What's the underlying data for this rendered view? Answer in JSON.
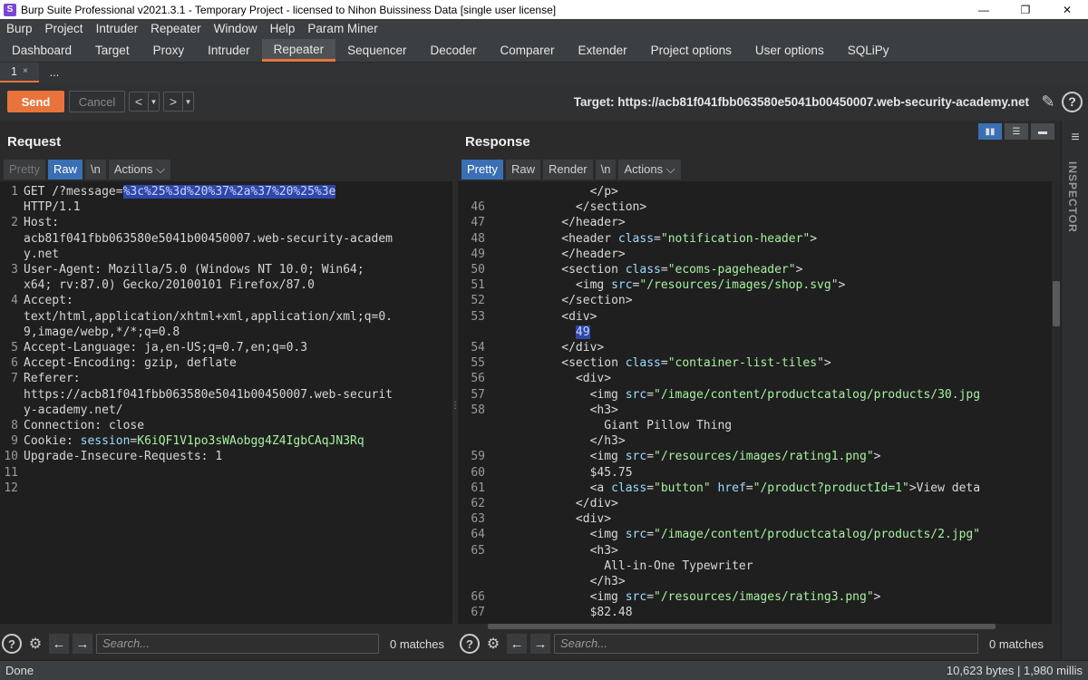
{
  "window": {
    "title": "Burp Suite Professional v2021.3.1 - Temporary Project - licensed to Nihon Buissiness Data [single user license]",
    "app_icon": "S",
    "minimize": "—",
    "restore": "❐",
    "close": "✕"
  },
  "menu": [
    "Burp",
    "Project",
    "Intruder",
    "Repeater",
    "Window",
    "Help",
    "Param Miner"
  ],
  "tabs": [
    "Dashboard",
    "Target",
    "Proxy",
    "Intruder",
    "Repeater",
    "Sequencer",
    "Decoder",
    "Comparer",
    "Extender",
    "Project options",
    "User options",
    "SQLiPy"
  ],
  "active_tab": "Repeater",
  "subtabs": [
    {
      "label": "1",
      "close": "×"
    },
    {
      "label": "...",
      "close": ""
    }
  ],
  "toolbar": {
    "send": "Send",
    "cancel": "Cancel",
    "back": "<",
    "forward": ">",
    "dropdown": "▼",
    "target": "Target: https://acb81f041fbb063580e5041b00450007.web-security-academy.net",
    "help": "?",
    "edit_icon": "pencil-icon"
  },
  "request": {
    "title": "Request",
    "buttons": [
      "Pretty",
      "Raw",
      "\\n",
      "Actions ⌵"
    ],
    "active": "Raw"
  },
  "response": {
    "title": "Response",
    "buttons": [
      "Pretty",
      "Raw",
      "Render",
      "\\n",
      "Actions ⌵"
    ],
    "active": "Pretty"
  },
  "request_lines": [
    {
      "ln": "1",
      "segs": [
        [
          "c-key",
          "GET /?message="
        ],
        [
          "c-hl",
          "%3c%25%3d%20%37%2a%37%20%25%3e"
        ]
      ]
    },
    {
      "ln": "",
      "segs": [
        [
          "c-key",
          "HTTP/1.1"
        ]
      ]
    },
    {
      "ln": "2",
      "segs": [
        [
          "c-key",
          "Host:"
        ]
      ]
    },
    {
      "ln": "",
      "segs": [
        [
          "c-text",
          "acb81f041fbb063580e5041b00450007.web-security-academ"
        ]
      ]
    },
    {
      "ln": "",
      "segs": [
        [
          "c-text",
          "y.net"
        ]
      ]
    },
    {
      "ln": "3",
      "segs": [
        [
          "c-key",
          "User-Agent: "
        ],
        [
          "c-text",
          "Mozilla/5.0 (Windows NT 10.0; Win64;"
        ]
      ]
    },
    {
      "ln": "",
      "segs": [
        [
          "c-text",
          "x64; rv:87.0) Gecko/20100101 Firefox/87.0"
        ]
      ]
    },
    {
      "ln": "4",
      "segs": [
        [
          "c-key",
          "Accept:"
        ]
      ]
    },
    {
      "ln": "",
      "segs": [
        [
          "c-text",
          "text/html,application/xhtml+xml,application/xml;q=0."
        ]
      ]
    },
    {
      "ln": "",
      "segs": [
        [
          "c-text",
          "9,image/webp,*/*;q=0.8"
        ]
      ]
    },
    {
      "ln": "5",
      "segs": [
        [
          "c-key",
          "Accept-Language: "
        ],
        [
          "c-text",
          "ja,en-US;q=0.7,en;q=0.3"
        ]
      ]
    },
    {
      "ln": "6",
      "segs": [
        [
          "c-key",
          "Accept-Encoding: "
        ],
        [
          "c-text",
          "gzip, deflate"
        ]
      ]
    },
    {
      "ln": "7",
      "segs": [
        [
          "c-key",
          "Referer:"
        ]
      ]
    },
    {
      "ln": "",
      "segs": [
        [
          "c-text",
          "https://acb81f041fbb063580e5041b00450007.web-securit"
        ]
      ]
    },
    {
      "ln": "",
      "segs": [
        [
          "c-text",
          "y-academy.net/"
        ]
      ]
    },
    {
      "ln": "8",
      "segs": [
        [
          "c-key",
          "Connection: "
        ],
        [
          "c-text",
          "close"
        ]
      ]
    },
    {
      "ln": "9",
      "segs": [
        [
          "c-key",
          "Cookie: "
        ],
        [
          "c-cookie-name",
          "session"
        ],
        [
          "c-key",
          "="
        ],
        [
          "c-cookie-val",
          "K6iQF1V1po3sWAobgg4Z4IgbCAqJN3Rq"
        ]
      ]
    },
    {
      "ln": "10",
      "segs": [
        [
          "c-key",
          "Upgrade-Insecure-Requests: "
        ],
        [
          "c-text",
          "1"
        ]
      ]
    },
    {
      "ln": "11",
      "segs": []
    },
    {
      "ln": "12",
      "segs": []
    }
  ],
  "response_lines": [
    {
      "ln": "",
      "segs": [
        [
          "c-text",
          "              "
        ],
        [
          "c-tag",
          "</p>"
        ]
      ]
    },
    {
      "ln": "46",
      "segs": [
        [
          "c-text",
          "            "
        ],
        [
          "c-tag",
          "</section>"
        ]
      ]
    },
    {
      "ln": "47",
      "segs": [
        [
          "c-text",
          "          "
        ],
        [
          "c-tag",
          "</header>"
        ]
      ]
    },
    {
      "ln": "48",
      "segs": [
        [
          "c-text",
          "          "
        ],
        [
          "c-tag",
          "<header "
        ],
        [
          "c-attr",
          "class"
        ],
        [
          "c-tag",
          "="
        ],
        [
          "c-val",
          "\"notification-header\""
        ],
        [
          "c-tag",
          ">"
        ]
      ]
    },
    {
      "ln": "49",
      "segs": [
        [
          "c-text",
          "          "
        ],
        [
          "c-tag",
          "</header>"
        ]
      ]
    },
    {
      "ln": "50",
      "segs": [
        [
          "c-text",
          "          "
        ],
        [
          "c-tag",
          "<section "
        ],
        [
          "c-attr",
          "class"
        ],
        [
          "c-tag",
          "="
        ],
        [
          "c-val",
          "\"ecoms-pageheader\""
        ],
        [
          "c-tag",
          ">"
        ]
      ]
    },
    {
      "ln": "51",
      "segs": [
        [
          "c-text",
          "            "
        ],
        [
          "c-tag",
          "<img "
        ],
        [
          "c-attr",
          "src"
        ],
        [
          "c-tag",
          "="
        ],
        [
          "c-val",
          "\"/resources/images/shop.svg\""
        ],
        [
          "c-tag",
          ">"
        ]
      ]
    },
    {
      "ln": "52",
      "segs": [
        [
          "c-text",
          "          "
        ],
        [
          "c-tag",
          "</section>"
        ]
      ]
    },
    {
      "ln": "53",
      "segs": [
        [
          "c-text",
          "          "
        ],
        [
          "c-tag",
          "<div>"
        ]
      ]
    },
    {
      "ln": "",
      "segs": [
        [
          "c-text",
          "            "
        ],
        [
          "c-hl",
          "49"
        ]
      ]
    },
    {
      "ln": "54",
      "segs": [
        [
          "c-text",
          "          "
        ],
        [
          "c-tag",
          "</div>"
        ]
      ]
    },
    {
      "ln": "55",
      "segs": [
        [
          "c-text",
          "          "
        ],
        [
          "c-tag",
          "<section "
        ],
        [
          "c-attr",
          "class"
        ],
        [
          "c-tag",
          "="
        ],
        [
          "c-val",
          "\"container-list-tiles\""
        ],
        [
          "c-tag",
          ">"
        ]
      ]
    },
    {
      "ln": "56",
      "segs": [
        [
          "c-text",
          "            "
        ],
        [
          "c-tag",
          "<div>"
        ]
      ]
    },
    {
      "ln": "57",
      "segs": [
        [
          "c-text",
          "              "
        ],
        [
          "c-tag",
          "<img "
        ],
        [
          "c-attr",
          "src"
        ],
        [
          "c-tag",
          "="
        ],
        [
          "c-val",
          "\"/image/content/productcatalog/products/30.jpg"
        ]
      ]
    },
    {
      "ln": "58",
      "segs": [
        [
          "c-text",
          "              "
        ],
        [
          "c-tag",
          "<h3>"
        ]
      ]
    },
    {
      "ln": "",
      "segs": [
        [
          "c-text",
          "                Giant Pillow Thing"
        ]
      ]
    },
    {
      "ln": "",
      "segs": [
        [
          "c-text",
          "              "
        ],
        [
          "c-tag",
          "</h3>"
        ]
      ]
    },
    {
      "ln": "59",
      "segs": [
        [
          "c-text",
          "              "
        ],
        [
          "c-tag",
          "<img "
        ],
        [
          "c-attr",
          "src"
        ],
        [
          "c-tag",
          "="
        ],
        [
          "c-val",
          "\"/resources/images/rating1.png\""
        ],
        [
          "c-tag",
          ">"
        ]
      ]
    },
    {
      "ln": "60",
      "segs": [
        [
          "c-text",
          "              $45.75"
        ]
      ]
    },
    {
      "ln": "61",
      "segs": [
        [
          "c-text",
          "              "
        ],
        [
          "c-tag",
          "<a "
        ],
        [
          "c-attr",
          "class"
        ],
        [
          "c-tag",
          "="
        ],
        [
          "c-val",
          "\"button\" "
        ],
        [
          "c-attr",
          "href"
        ],
        [
          "c-tag",
          "="
        ],
        [
          "c-val",
          "\"/product?productId=1\""
        ],
        [
          "c-tag",
          ">View deta"
        ]
      ]
    },
    {
      "ln": "62",
      "segs": [
        [
          "c-text",
          "            "
        ],
        [
          "c-tag",
          "</div>"
        ]
      ]
    },
    {
      "ln": "63",
      "segs": [
        [
          "c-text",
          "            "
        ],
        [
          "c-tag",
          "<div>"
        ]
      ]
    },
    {
      "ln": "64",
      "segs": [
        [
          "c-text",
          "              "
        ],
        [
          "c-tag",
          "<img "
        ],
        [
          "c-attr",
          "src"
        ],
        [
          "c-tag",
          "="
        ],
        [
          "c-val",
          "\"/image/content/productcatalog/products/2.jpg\""
        ]
      ]
    },
    {
      "ln": "65",
      "segs": [
        [
          "c-text",
          "              "
        ],
        [
          "c-tag",
          "<h3>"
        ]
      ]
    },
    {
      "ln": "",
      "segs": [
        [
          "c-text",
          "                All-in-One Typewriter"
        ]
      ]
    },
    {
      "ln": "",
      "segs": [
        [
          "c-text",
          "              "
        ],
        [
          "c-tag",
          "</h3>"
        ]
      ]
    },
    {
      "ln": "66",
      "segs": [
        [
          "c-text",
          "              "
        ],
        [
          "c-tag",
          "<img "
        ],
        [
          "c-attr",
          "src"
        ],
        [
          "c-tag",
          "="
        ],
        [
          "c-val",
          "\"/resources/images/rating3.png\""
        ],
        [
          "c-tag",
          ">"
        ]
      ]
    },
    {
      "ln": "67",
      "segs": [
        [
          "c-text",
          "              $82.48"
        ]
      ]
    }
  ],
  "search": {
    "placeholder": "Search...",
    "req_matches": "0 matches",
    "resp_matches": "0 matches",
    "prev": "←",
    "next": "→",
    "help": "?",
    "settings": "⚙"
  },
  "inspector": {
    "label": "INSPECTOR",
    "menu": "≡"
  },
  "status": {
    "left": "Done",
    "right": "10,623 bytes | 1,980 millis"
  }
}
